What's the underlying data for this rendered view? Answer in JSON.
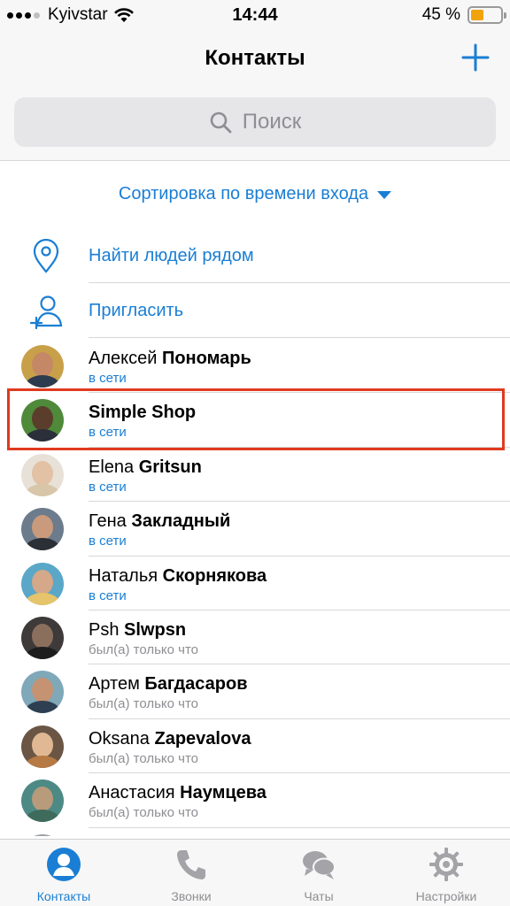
{
  "status_bar": {
    "carrier": "Kyivstar",
    "time": "14:44",
    "battery": "45 %",
    "battery_level": 0.45
  },
  "nav": {
    "title": "Контакты"
  },
  "search": {
    "placeholder": "Поиск"
  },
  "sort": {
    "label": "Сортировка по времени входа"
  },
  "actions": [
    {
      "label": "Найти людей рядом",
      "icon": "location-pin-icon"
    },
    {
      "label": "Пригласить",
      "icon": "add-person-icon"
    }
  ],
  "contacts": [
    {
      "first": "Алексей",
      "last": "Пономарь",
      "status": "в сети",
      "online": true,
      "colors": {
        "bg": "#c9a04a",
        "face": "#c48866",
        "body": "#2d3b4e"
      }
    },
    {
      "first": "",
      "last": "Simple Shop",
      "status": "в сети",
      "online": true,
      "colors": {
        "bg": "#4f8a3a",
        "face": "#5a3e2b",
        "body": "#2a2f3a"
      }
    },
    {
      "first": "Elena",
      "last": "Gritsun",
      "status": "в сети",
      "online": true,
      "colors": {
        "bg": "#e8e1d8",
        "face": "#e2c1a4",
        "body": "#d8c6a8"
      }
    },
    {
      "first": "Гена",
      "last": "Закладный",
      "status": "в сети",
      "online": true,
      "colors": {
        "bg": "#6c7c8c",
        "face": "#c99a7c",
        "body": "#2b2f36"
      }
    },
    {
      "first": "Наталья",
      "last": "Скорнякова",
      "status": "в сети",
      "online": true,
      "colors": {
        "bg": "#5aa7c8",
        "face": "#d4a888",
        "body": "#e6c46b"
      }
    },
    {
      "first": "Psh",
      "last": "Slwpsn",
      "status": "был(а) только что",
      "online": false,
      "colors": {
        "bg": "#3e3a3a",
        "face": "#8b6f5d",
        "body": "#1d1d1d"
      }
    },
    {
      "first": "Артем",
      "last": "Багдасаров",
      "status": "был(а) только что",
      "online": false,
      "colors": {
        "bg": "#7fa8b8",
        "face": "#c59272",
        "body": "#2e3f52"
      }
    },
    {
      "first": "Oksana",
      "last": "Zapevalova",
      "status": "был(а) только что",
      "online": false,
      "colors": {
        "bg": "#6b5645",
        "face": "#e0b894",
        "body": "#b67a45"
      }
    },
    {
      "first": "Анастасия",
      "last": "Наумцева",
      "status": "был(а) только что",
      "online": false,
      "colors": {
        "bg": "#4d8a86",
        "face": "#b89b7a",
        "body": "#3f6b5c"
      }
    },
    {
      "first": "",
      "last": "",
      "status": "",
      "online": false,
      "colors": {
        "bg": "#9aa0a6",
        "face": "#c7a891",
        "body": "#55606a"
      }
    }
  ],
  "tabs": [
    {
      "label": "Контакты",
      "icon": "contacts-icon",
      "active": true
    },
    {
      "label": "Звонки",
      "icon": "phone-icon",
      "active": false
    },
    {
      "label": "Чаты",
      "icon": "chat-bubbles-icon",
      "active": false
    },
    {
      "label": "Настройки",
      "icon": "gear-icon",
      "active": false
    }
  ],
  "colors": {
    "accent": "#1a7ed4",
    "highlight": "#e03a1e",
    "secondary_text": "#8e8e93"
  }
}
